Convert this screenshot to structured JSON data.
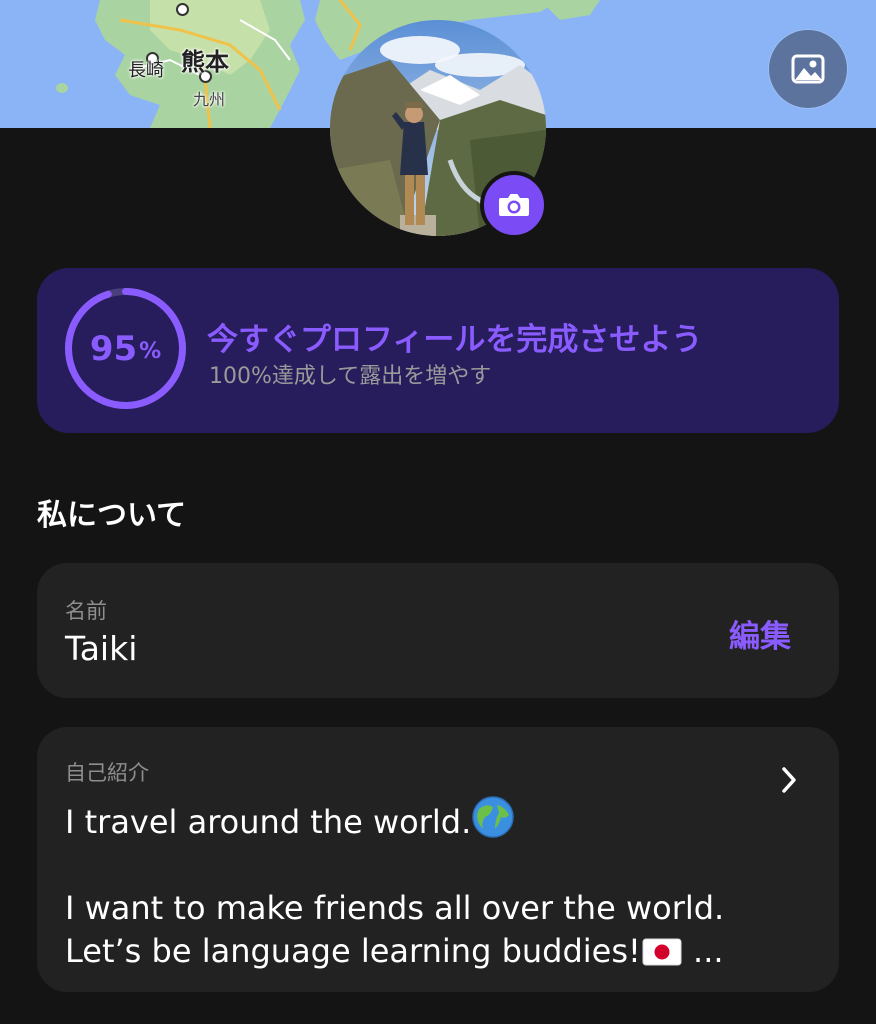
{
  "map": {
    "labels": [
      "長崎",
      "熊本",
      "九州"
    ]
  },
  "cover": {
    "icon": "image-photo-icon"
  },
  "avatar": {
    "camera_icon": "camera-icon"
  },
  "progress": {
    "percent": 95,
    "percent_num": "95",
    "percent_unit": "%",
    "title": "今すぐプロフィールを完成させよう",
    "subtitle": "100%達成して露出を増やす"
  },
  "section": {
    "title": "私について"
  },
  "name_field": {
    "label": "名前",
    "value": "Taiki",
    "edit_label": "編集"
  },
  "bio_field": {
    "label": "自己紹介",
    "line1": "I travel around the world.",
    "line2": "I want to make friends all over the world.",
    "line3": "Let’s be language learning buddies!",
    "ellipsis": "..."
  },
  "colors": {
    "accent": "#8a5cff",
    "progress_card": "#271c5c",
    "background": "#141414",
    "card": "#222222"
  }
}
